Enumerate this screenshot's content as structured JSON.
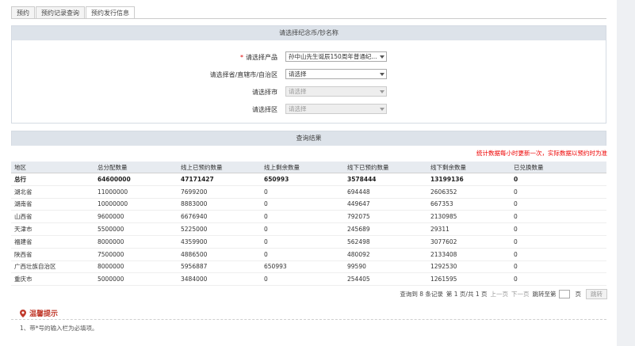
{
  "tabs": [
    "预约",
    "预约记录查询",
    "预约发行信息"
  ],
  "select_panel": {
    "title": "请选择纪念币/钞名称",
    "fields": [
      {
        "label": "请选择产品",
        "required": true,
        "value": "孙中山先生诞辰150周年普通纪...",
        "disabled": false
      },
      {
        "label": "请选择省/直辖市/自治区",
        "required": false,
        "value": "请选择",
        "disabled": false
      },
      {
        "label": "请选择市",
        "required": false,
        "value": "请选择",
        "disabled": true
      },
      {
        "label": "请选择区",
        "required": false,
        "value": "请选择",
        "disabled": true
      }
    ],
    "colon": ":",
    "required_mark": "*"
  },
  "results_panel": {
    "title": "查询结果",
    "notice": "统计数据每小时更新一次，实际数据以预约时为准"
  },
  "table": {
    "headers": [
      "地区",
      "总分配数量",
      "线上已预约数量",
      "线上剩余数量",
      "线下已预约数量",
      "线下剩余数量",
      "已兑换数量"
    ],
    "total": [
      "总行",
      "64600000",
      "47171427",
      "650993",
      "3578444",
      "13199136",
      "0"
    ],
    "rows": [
      [
        "湖北省",
        "11000000",
        "7699200",
        "0",
        "694448",
        "2606352",
        "0"
      ],
      [
        "湖南省",
        "10000000",
        "8883000",
        "0",
        "449647",
        "667353",
        "0"
      ],
      [
        "山西省",
        "9600000",
        "6676940",
        "0",
        "792075",
        "2130985",
        "0"
      ],
      [
        "天津市",
        "5500000",
        "5225000",
        "0",
        "245689",
        "29311",
        "0"
      ],
      [
        "福建省",
        "8000000",
        "4359900",
        "0",
        "562498",
        "3077602",
        "0"
      ],
      [
        "陕西省",
        "7500000",
        "4886500",
        "0",
        "480092",
        "2133408",
        "0"
      ],
      [
        "广西壮族自治区",
        "8000000",
        "5956887",
        "650993",
        "99590",
        "1292530",
        "0"
      ],
      [
        "重庆市",
        "5000000",
        "3484000",
        "0",
        "254405",
        "1261595",
        "0"
      ]
    ]
  },
  "pager": {
    "summary": "查询到 8 条记录",
    "page_info": "第 1 页/共 1 页",
    "prev": "上一页",
    "next": "下一页",
    "jump_label": "跳转至第",
    "page_unit": "页",
    "jump_button": "跳转"
  },
  "tips": {
    "title": "温馨提示",
    "items": [
      "1、带*号的输入栏为必填项。"
    ]
  },
  "colors": {
    "accent": "#c0392b",
    "header_bg": "#dde3ea",
    "notice": "#ee0000"
  }
}
